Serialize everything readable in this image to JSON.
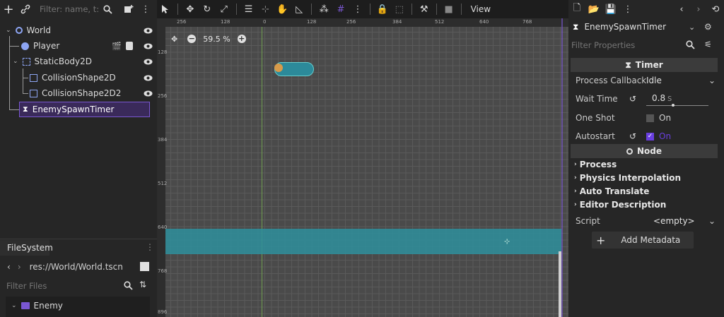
{
  "scene": {
    "filter_placeholder": "Filter: name, t:t",
    "nodes": [
      {
        "label": "World"
      },
      {
        "label": "Player"
      },
      {
        "label": "StaticBody2D"
      },
      {
        "label": "CollisionShape2D"
      },
      {
        "label": "CollisionShape2D2"
      },
      {
        "label": "EnemySpawnTimer"
      }
    ]
  },
  "viewport": {
    "zoom": "59.5 %",
    "view_menu": "View",
    "ruler_top": [
      "256",
      "128",
      "0",
      "128",
      "256",
      "384",
      "512",
      "640",
      "768"
    ],
    "ruler_left": [
      "128",
      "256",
      "384",
      "512",
      "640",
      "768",
      "896"
    ]
  },
  "filesystem": {
    "title": "FileSystem",
    "path": "res://World/World.tscn",
    "filter_placeholder": "Filter Files",
    "items": [
      {
        "label": "Enemy"
      }
    ]
  },
  "inspector": {
    "node_name": "EnemySpawnTimer",
    "filter_placeholder": "Filter Properties",
    "timer_section": "Timer",
    "process_callback_label": "Process Callback",
    "process_callback_value": "Idle",
    "wait_time_label": "Wait Time",
    "wait_time_value": "0.8",
    "wait_time_unit": "s",
    "one_shot_label": "One Shot",
    "one_shot_value": "On",
    "autostart_label": "Autostart",
    "autostart_value": "On",
    "node_section": "Node",
    "groups": [
      "Process",
      "Physics Interpolation",
      "Auto Translate",
      "Editor Description"
    ],
    "script_label": "Script",
    "script_value": "<empty>",
    "add_metadata": "Add Metadata"
  },
  "colors": {
    "accent": "#7a57d1",
    "checkbox": "#6a3fe0",
    "floor": "#2e8f9c"
  }
}
